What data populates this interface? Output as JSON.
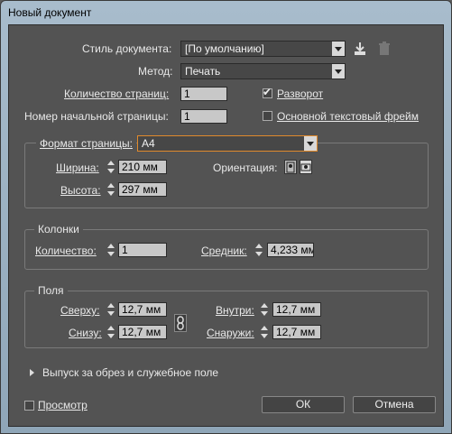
{
  "window": {
    "title": "Новый документ"
  },
  "doc_preset": {
    "label": "Стиль документа:",
    "value": "[По умолчанию]"
  },
  "intent": {
    "label": "Метод:",
    "value": "Печать"
  },
  "pages_count": {
    "label": "Количество страниц:",
    "value": "1"
  },
  "facing_pages": {
    "label": "Разворот",
    "checked": true
  },
  "start_page": {
    "label": "Номер начальной страницы:",
    "value": "1"
  },
  "primary_text_frame": {
    "label": "Основной текстовый фрейм",
    "checked": false
  },
  "page_size": {
    "label": "Формат страницы:",
    "value": "A4",
    "width_label": "Ширина:",
    "width": "210 мм",
    "height_label": "Высота:",
    "height": "297 мм",
    "orientation_label": "Ориентация:"
  },
  "columns": {
    "legend": "Колонки",
    "count_label": "Количество:",
    "count": "1",
    "gutter_label": "Средник:",
    "gutter": "4,233 мм"
  },
  "margins": {
    "legend": "Поля",
    "top_label": "Сверху:",
    "top": "12,7 мм",
    "bottom_label": "Снизу:",
    "bottom": "12,7 мм",
    "inside_label": "Внутри:",
    "inside": "12,7 мм",
    "outside_label": "Снаружи:",
    "outside": "12,7 мм"
  },
  "bleed_slug": {
    "label": "Выпуск за обрез и служебное поле"
  },
  "preview": {
    "label": "Просмотр",
    "checked": false
  },
  "buttons": {
    "ok": "ОК",
    "cancel": "Отмена"
  }
}
